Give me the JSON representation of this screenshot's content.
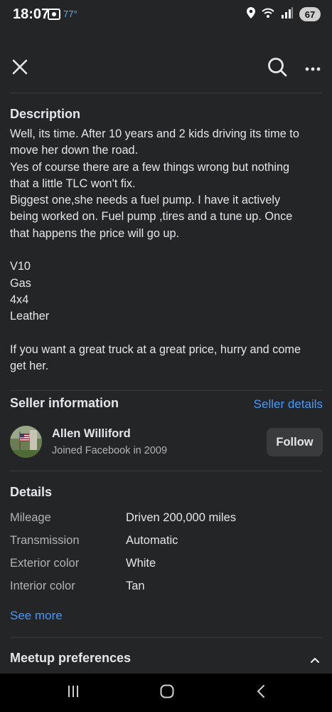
{
  "status_bar": {
    "time": "18:07",
    "temperature": "77°",
    "battery": "67"
  },
  "description": {
    "heading": "Description",
    "lines": [
      "Well, its time. After 10 years and 2 kids driving its time to",
      "move her down the road.",
      "Yes of course there are a few things wrong but nothing",
      "that a little TLC won't fix.",
      "Biggest one,she needs a fuel pump. I have it actively",
      "being worked on. Fuel pump ,tires and a tune up. Once",
      "that happens the price will go up.",
      "",
      "V10",
      "Gas",
      "4x4",
      "Leather",
      "",
      "If you want a great truck at a great price, hurry and come",
      "get her."
    ]
  },
  "seller": {
    "heading": "Seller information",
    "details_link": "Seller details",
    "name": "Allen Williford",
    "joined": "Joined Facebook in 2009",
    "follow_label": "Follow"
  },
  "details": {
    "heading": "Details",
    "rows": [
      {
        "label": "Mileage",
        "value": "Driven 200,000 miles"
      },
      {
        "label": "Transmission",
        "value": "Automatic"
      },
      {
        "label": "Exterior color",
        "value": "White"
      },
      {
        "label": "Interior color",
        "value": "Tan"
      }
    ],
    "see_more": "See more"
  },
  "meetup": {
    "heading": "Meetup preferences"
  },
  "colors": {
    "background": "#242526",
    "text": "#e4e6eb",
    "secondary_text": "#b0b3b8",
    "link": "#4599ff",
    "button_bg": "#3a3b3c"
  },
  "icons": {
    "close": "close-icon",
    "search": "search-icon",
    "more": "more-icon",
    "collapse": "chevron-up-icon"
  }
}
